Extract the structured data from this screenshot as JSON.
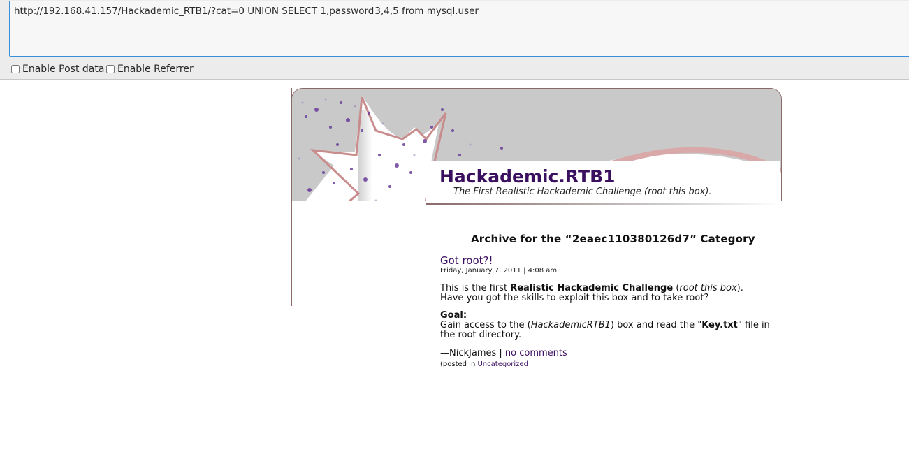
{
  "hackbar": {
    "url_before_caret": "http://192.168.41.157/Hackademic_RTB1/?cat=0 UNION SELECT 1,password",
    "url_after_caret": "3,4,5 from mysql.user",
    "post_data_label": "Enable Post data",
    "referrer_label": "Enable Referrer",
    "post_data_checked": false,
    "referrer_checked": false
  },
  "blog": {
    "title": "Hackademic.RTB1",
    "description": "The First Realistic Hackademic Challenge (root this box)."
  },
  "archive": {
    "heading": "Archive for the “2eaec110380126d7” Category"
  },
  "post": {
    "title": "Got root?!",
    "date": "Friday, January 7, 2011 | 4:08 am",
    "line1_a": "This is the first ",
    "line1_b": "Realistic Hackademic Challenge",
    "line1_c": " (",
    "line1_d": "root this box",
    "line1_e": ").",
    "line2": "Have you got the skills to exploit this box and to take root?",
    "goal_label": "Goal:",
    "goal_a": "Gain access to the (",
    "goal_b": "HackademicRTB1",
    "goal_c": ") box and read the \"",
    "goal_d": "Key.txt",
    "goal_e": "\" file in",
    "goal_line2": "the root directory.",
    "author": "—NickJames | ",
    "comments_link": "no comments",
    "posted_in": "(posted in ",
    "category_link": "Uncategorized"
  },
  "colors": {
    "title_purple": "#3b0f5f",
    "url_border": "#3a8fd9",
    "frame": "#8a6a6a"
  }
}
